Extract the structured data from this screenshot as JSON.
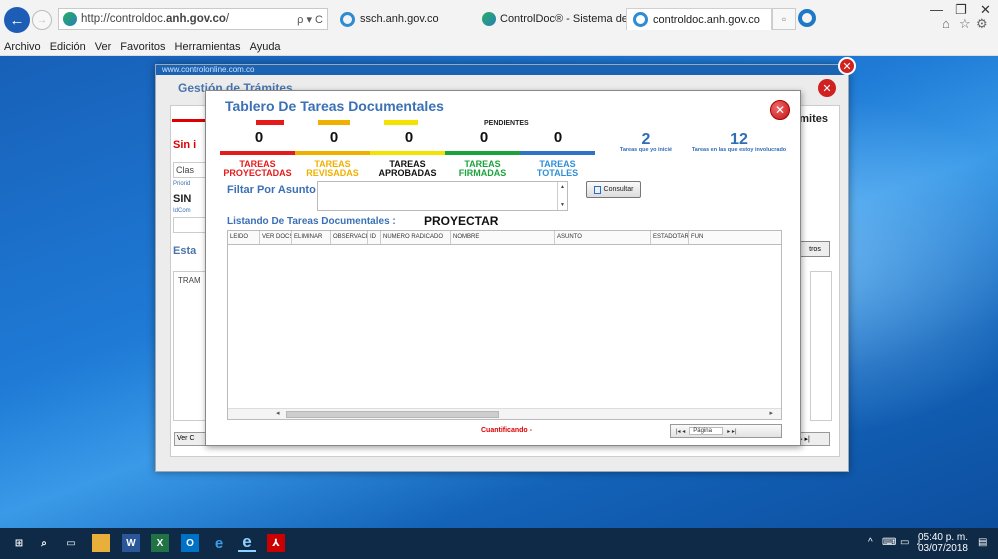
{
  "browser": {
    "url_prefix": "http://controldoc.",
    "url_bold": "anh.gov.co",
    "url_suffix": "/",
    "address_actions": "ρ ▾ C",
    "tabs": [
      {
        "label": "ssch.anh.gov.co"
      },
      {
        "label": "ControlDoc® - Sistema de ..."
      },
      {
        "label": "controldoc.anh.gov.co"
      }
    ],
    "menu": [
      "Archivo",
      "Edición",
      "Ver",
      "Favoritos",
      "Herramientas",
      "Ayuda"
    ]
  },
  "outer_modal": {
    "header_url": "www.controlonline.com.co",
    "title": "Gestión de Trámites"
  },
  "background_form": {
    "sin_label": "Sin i",
    "field1": "Clas",
    "prioridad": "Priorid",
    "sin2": "SIN",
    "idcom": "IdCom",
    "esta": "Esta",
    "tram": "TRAM",
    "mites": "mites",
    "tros": "tros",
    "ver_c": "Ver C"
  },
  "tablero": {
    "title": "Tablero De Tareas Documentales",
    "pendientes_label": "PENDIENTES",
    "counts": [
      {
        "value": "0",
        "label_1": "TAREAS",
        "label_2": "PROYECTADAS",
        "color": "#e31b1b"
      },
      {
        "value": "0",
        "label_1": "TAREAS",
        "label_2": "REVISADAS",
        "color": "#f0b000"
      },
      {
        "value": "0",
        "label_1": "TAREAS",
        "label_2": "APROBADAS",
        "color": "#111111"
      },
      {
        "value": "0",
        "label_1": "TAREAS",
        "label_2": "FIRMADAS",
        "color": "#1aa33a"
      },
      {
        "value": "0",
        "label_1": "TAREAS",
        "label_2": "TOTALES",
        "color": "#2f8fd6"
      }
    ],
    "stripe_colors": [
      "#e31b1b",
      "#f0b000",
      "#f2e400",
      "#1aa33a",
      "#2f73c8"
    ],
    "iniciadas": {
      "value": "2",
      "caption": "Tareas que yo inicié"
    },
    "involucrado": {
      "value": "12",
      "caption": "Tareas en las que estoy involucrado"
    },
    "filter_label": "Filtar Por Asunto :",
    "filter_value": "",
    "consult_button": "Consultar",
    "list_label": "Listando De Tareas Documentales :",
    "list_mode": "PROYECTAR",
    "columns": [
      "LEIDO",
      "VER DOCS",
      "ELIMINAR",
      "OBSERVACIO",
      "ID",
      "NUMERO RADICADO",
      "NOMBRE",
      "ASUNTO",
      "ESTADOTAREA",
      "FUN"
    ],
    "status_text": "Cuantificando -",
    "pager_nav_left": "|◂ ◂",
    "pager_label": "Página",
    "pager_nav_right": "▸ ▸|"
  },
  "taskbar": {
    "time": "05:40 p. m.",
    "date": "03/07/2018"
  }
}
